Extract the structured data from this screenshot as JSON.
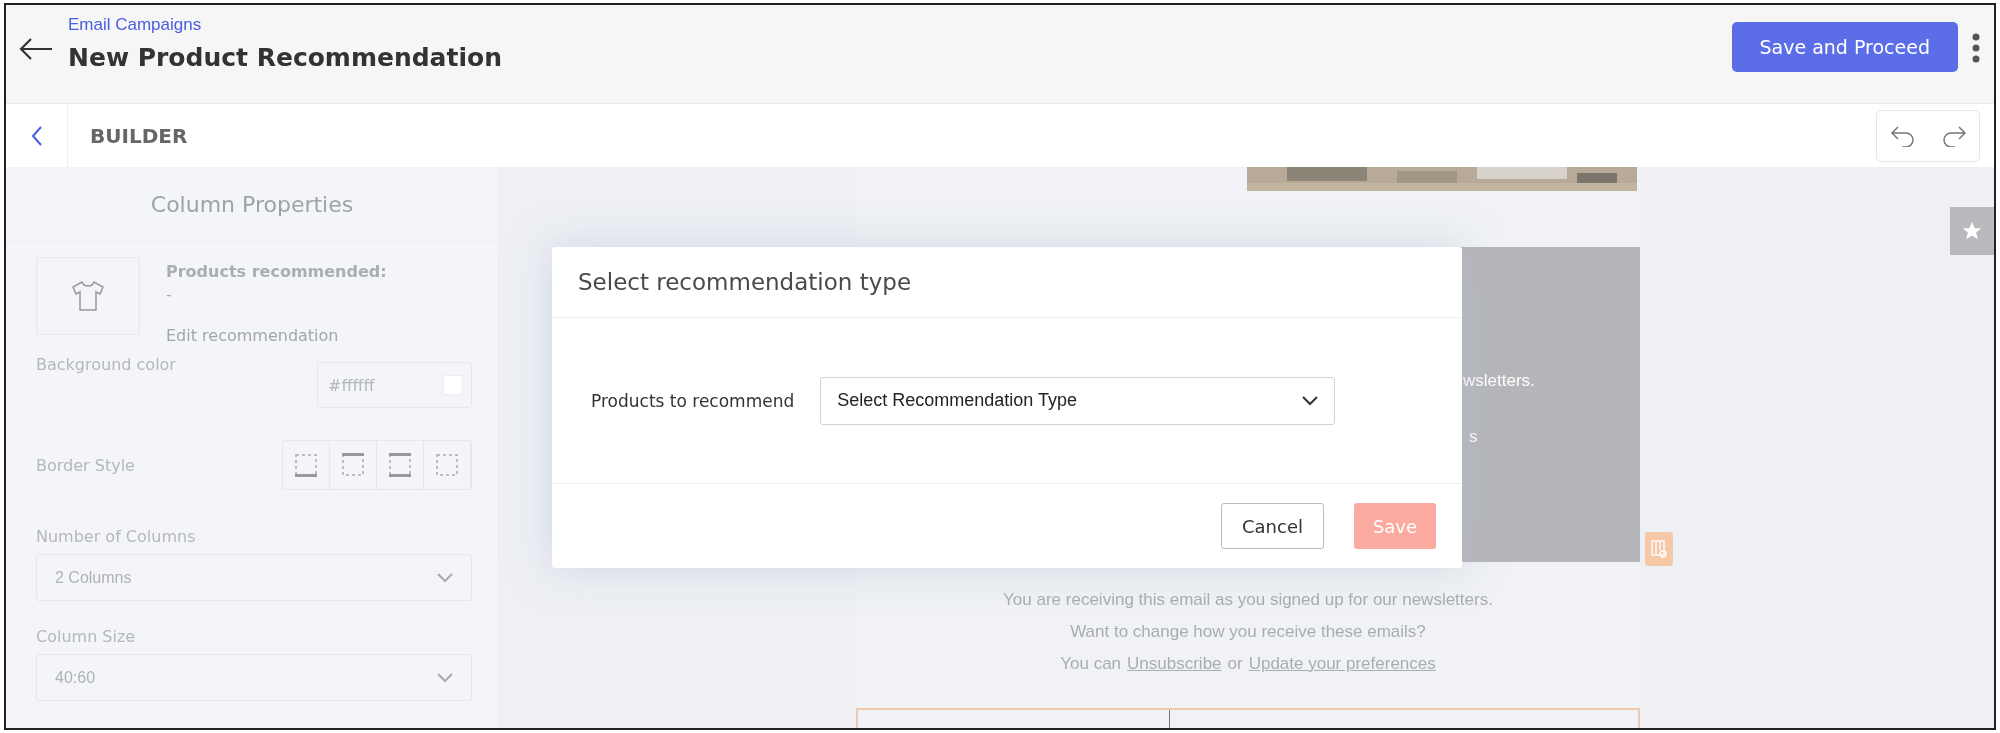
{
  "header": {
    "breadcrumb": "Email Campaigns",
    "title": "New Product Recommendation",
    "primary_button": "Save and Proceed"
  },
  "builder_bar": {
    "title": "BUILDER"
  },
  "column_properties": {
    "title": "Column Properties",
    "products_label": "Products recommended:",
    "products_value": "-",
    "edit_link": "Edit recommendation",
    "background": {
      "label": "Background color",
      "value": "#ffffff"
    },
    "border": {
      "label": "Border Style",
      "options": [
        {
          "kind": "bottom",
          "selected": false
        },
        {
          "kind": "top",
          "selected": false
        },
        {
          "kind": "both",
          "selected": false
        },
        {
          "kind": "none",
          "selected": false
        }
      ]
    },
    "columns": {
      "label": "Number of Columns",
      "value": "2 Columns"
    },
    "size": {
      "label": "Column Size",
      "value": "40:60"
    }
  },
  "email": {
    "hidden_fragments": [
      "wsletters.",
      "s"
    ],
    "footer_lines": [
      "You are receiving this email as you signed up for our newsletters.",
      "Want to change how you receive these emails?"
    ],
    "footer_links": {
      "prefix": "You can",
      "unsubscribe": "Unsubscribe",
      "middle": "or",
      "preferences": "Update your preferences"
    }
  },
  "modal": {
    "title": "Select recommendation type",
    "field_label": "Products to recommend",
    "select_value": "Select Recommendation Type",
    "cancel": "Cancel",
    "save": "Save",
    "save_disabled": true
  }
}
